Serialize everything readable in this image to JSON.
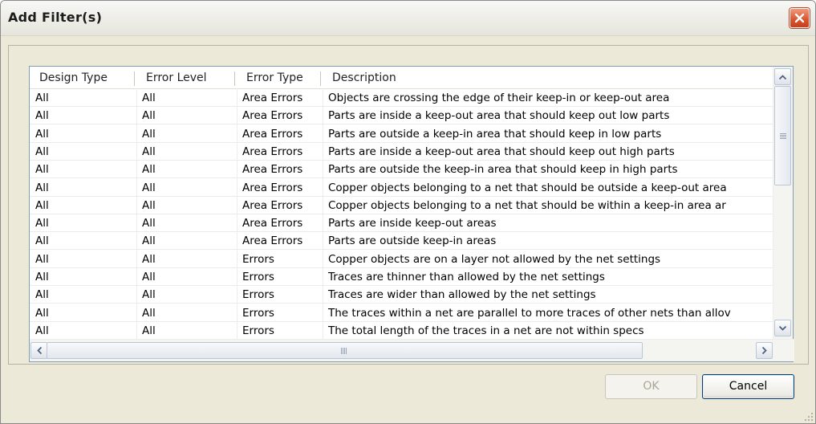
{
  "window": {
    "title": "Add Filter(s)"
  },
  "table": {
    "columns": [
      "Design Type",
      "Error Level",
      "Error Type",
      "Description"
    ],
    "rows": [
      [
        "All",
        "All",
        "Area Errors",
        "Objects are crossing the edge of their keep-in or keep-out area"
      ],
      [
        "All",
        "All",
        "Area Errors",
        "Parts are inside a keep-out area that should keep out low parts"
      ],
      [
        "All",
        "All",
        "Area Errors",
        "Parts are outside a keep-in area that should keep in low parts"
      ],
      [
        "All",
        "All",
        "Area Errors",
        "Parts are inside a keep-out area that should keep out high parts"
      ],
      [
        "All",
        "All",
        "Area Errors",
        "Parts are outside the keep-in area that should keep in high parts"
      ],
      [
        "All",
        "All",
        "Area Errors",
        "Copper objects belonging to a net that should be outside a keep-out area"
      ],
      [
        "All",
        "All",
        "Area Errors",
        "Copper objects belonging to a net that should be within a keep-in area ar"
      ],
      [
        "All",
        "All",
        "Area Errors",
        "Parts are inside keep-out areas"
      ],
      [
        "All",
        "All",
        "Area Errors",
        "Parts are outside keep-in areas"
      ],
      [
        "All",
        "All",
        "Errors",
        "Copper objects are on a layer not allowed by the net settings"
      ],
      [
        "All",
        "All",
        "Errors",
        "Traces are thinner than allowed by the net settings"
      ],
      [
        "All",
        "All",
        "Errors",
        "Traces are wider than allowed by the net settings"
      ],
      [
        "All",
        "All",
        "Errors",
        "The traces within a net are parallel to more traces of other nets than allov"
      ],
      [
        "All",
        "All",
        "Errors",
        "The total length of the traces in a net are not within specs"
      ]
    ]
  },
  "buttons": {
    "ok": "OK",
    "cancel": "Cancel"
  },
  "icons": {
    "close": "close-icon",
    "scroll_up": "arrow-up-icon",
    "scroll_down": "arrow-down-icon",
    "scroll_left": "arrow-left-icon",
    "scroll_right": "arrow-right-icon"
  },
  "colors": {
    "close_button": "#d9532f",
    "default_button_border": "#003c74"
  }
}
